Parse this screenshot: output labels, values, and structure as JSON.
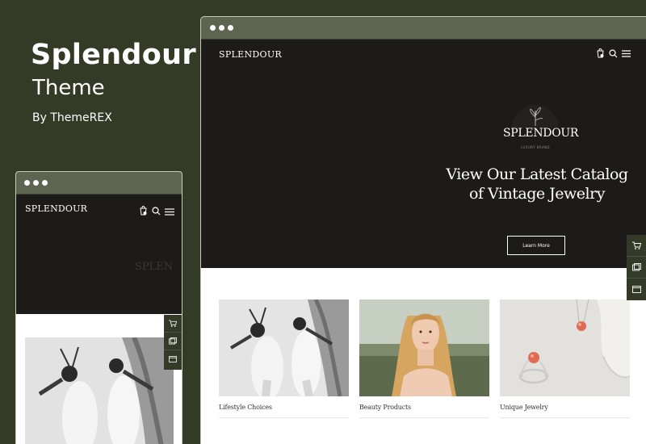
{
  "brand": {
    "title": "Splendour",
    "subtitle": "Theme",
    "byline": "By ThemeREX"
  },
  "site": {
    "logo": "SPLENDOUR",
    "header_icons": [
      "cart-icon",
      "search-icon",
      "menu-icon"
    ],
    "hero": {
      "emblem_logo": "SPLENDOUR",
      "emblem_tagline": "LUXURY BRAND",
      "heading_line1": "View Our Latest Catalog",
      "heading_line2": "of Vintage Jewelry",
      "button": "Learn More"
    },
    "cards": [
      {
        "label": "Lifestyle Choices"
      },
      {
        "label": "Beauty Products"
      },
      {
        "label": "Unique Jewelry"
      }
    ],
    "side_tools": [
      "cart-icon",
      "gallery-icon",
      "window-icon"
    ]
  },
  "mobile": {
    "logo": "SPLENDOUR",
    "hero_ghost_text": "SPLEN"
  },
  "colors": {
    "background": "#333a25",
    "chrome": "#5d6450",
    "hero": "#1d1b19",
    "tools": "#343a28"
  }
}
